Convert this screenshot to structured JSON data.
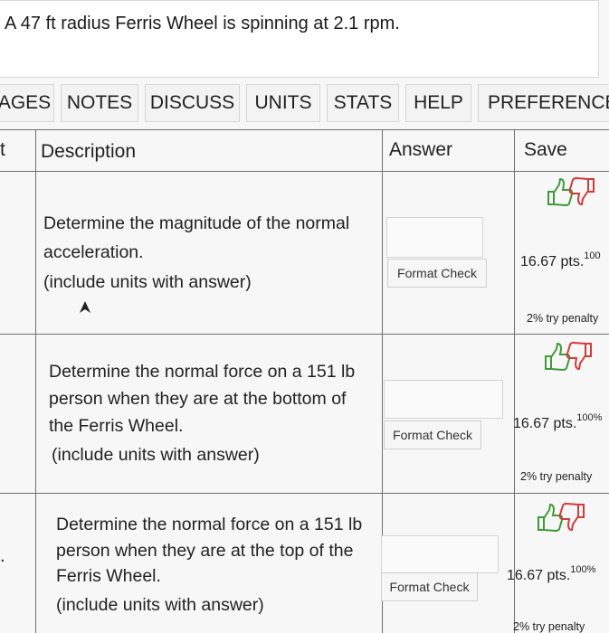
{
  "problem": {
    "text": "A 47 ft radius Ferris Wheel is spinning at 2.1 rpm."
  },
  "tabs": [
    {
      "label": "AGES",
      "name": "tab-pages"
    },
    {
      "label": "NOTES",
      "name": "tab-notes"
    },
    {
      "label": "DISCUSS",
      "name": "tab-discuss"
    },
    {
      "label": "UNITS",
      "name": "tab-units"
    },
    {
      "label": "STATS",
      "name": "tab-stats"
    },
    {
      "label": "HELP",
      "name": "tab-help"
    },
    {
      "label": "PREFERENCES",
      "name": "tab-preferences"
    }
  ],
  "table": {
    "col_left": "t",
    "col_description": "Description",
    "col_answer": "Answer",
    "col_save": "Save"
  },
  "rows": [
    {
      "desc1": "Determine the magnitude of the normal",
      "desc2": "acceleration.",
      "desc3": "(include units with answer)",
      "desc4": "",
      "format_check": "Format Check",
      "points": "16.67 pts.",
      "percent": "100",
      "penalty": "2% try penalty"
    },
    {
      "desc1": "Determine the normal force on a 151 lb",
      "desc2": "person when they are at the bottom of",
      "desc3": "the Ferris Wheel.",
      "desc4": "(include units with answer)",
      "format_check": "Format Check",
      "points": "16.67 pts.",
      "percent": "100%",
      "penalty": "2% try penalty"
    },
    {
      "desc1": "Determine the normal force on a 151 lb",
      "desc2": "person when they are at the top of the",
      "desc3": "Ferris Wheel.",
      "desc4": "(include units with answer)",
      "format_check": "Format Check",
      "points": "16.67 pts.",
      "percent": "100%",
      "penalty": "2% try penalty"
    }
  ],
  "left_markers": [
    "",
    "",
    "."
  ],
  "colors": {
    "thumb_up": "#3f9a3a",
    "thumb_down": "#d23b3b",
    "grid_line": "#6f6f6f"
  },
  "icons": [
    "thumbs-up-icon",
    "thumbs-down-icon",
    "cursor-arrow-icon"
  ]
}
